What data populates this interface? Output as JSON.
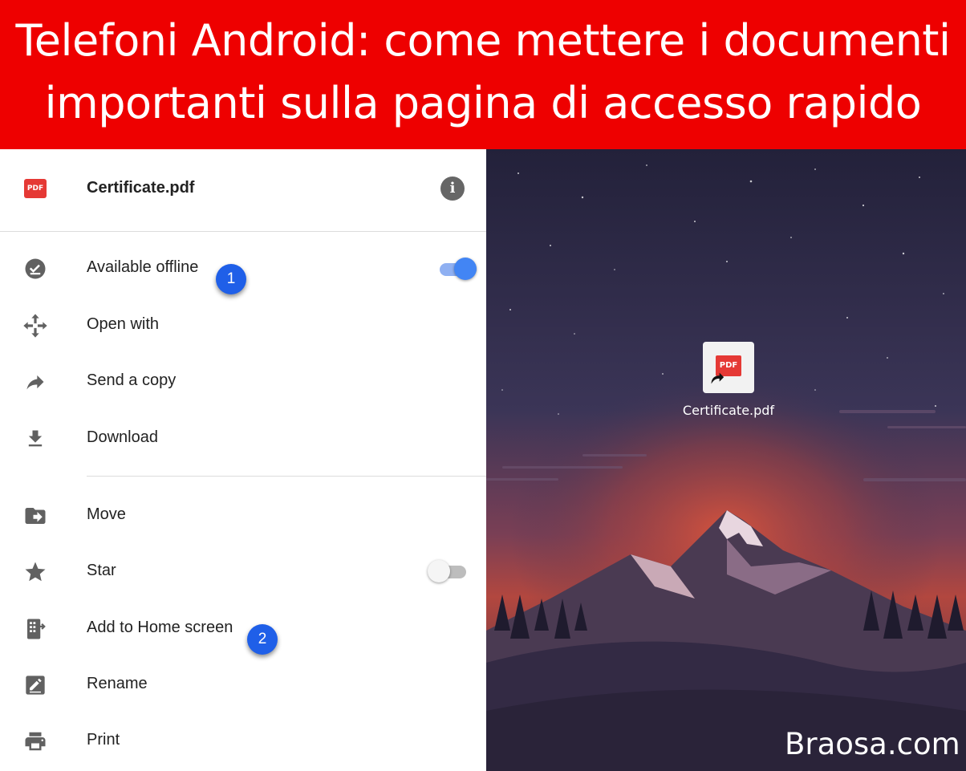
{
  "banner": {
    "line1": "Telefoni Android: come mettere i documenti",
    "line2": "importanti sulla pagina di accesso rapido",
    "color": "#ee0000"
  },
  "file": {
    "icon_text": "PDF",
    "name": "Certificate.pdf",
    "info_icon_glyph": "i"
  },
  "menu": {
    "available_offline": {
      "label": "Available offline",
      "icon": "offline-check-icon",
      "toggle_on": true
    },
    "open_with": {
      "label": "Open with",
      "icon": "open-with-icon"
    },
    "send_copy": {
      "label": "Send a copy",
      "icon": "share-arrow-icon"
    },
    "download": {
      "label": "Download",
      "icon": "download-icon"
    },
    "move": {
      "label": "Move",
      "icon": "move-folder-icon"
    },
    "star": {
      "label": "Star",
      "icon": "star-icon",
      "toggle_on": false
    },
    "add_home": {
      "label": "Add to Home screen",
      "icon": "add-home-screen-icon"
    },
    "rename": {
      "label": "Rename",
      "icon": "rename-pencil-icon"
    },
    "print": {
      "label": "Print",
      "icon": "print-icon"
    }
  },
  "badges": {
    "one": "1",
    "two": "2"
  },
  "colors": {
    "accent_blue": "#4285f4",
    "badge_blue": "#1f5fe8",
    "pdf_red": "#e53935"
  },
  "home_screen": {
    "shortcut_icon_text": "PDF",
    "shortcut_label": "Certificate.pdf"
  },
  "watermark": "Braosa.com"
}
